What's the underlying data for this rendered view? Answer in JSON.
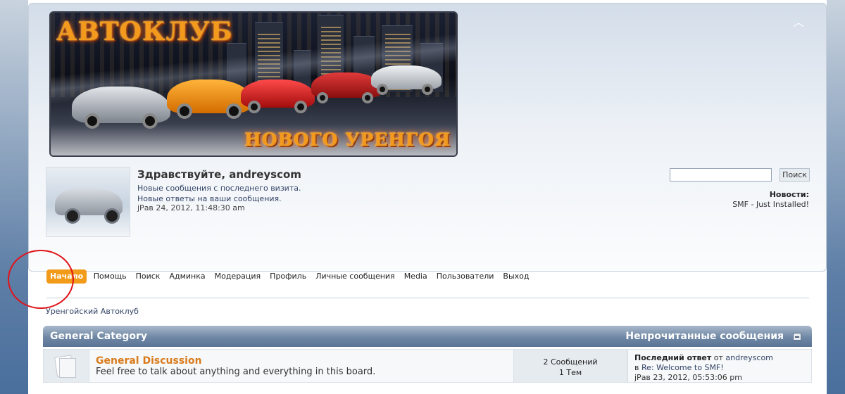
{
  "header": {
    "banner_title_line1": "АВТОКЛУБ",
    "banner_title_line2": "НОВОГО УРЕНГОЯ",
    "collapse_glyph": "︿"
  },
  "user": {
    "greeting": "Здравствуйте, andreyscom",
    "new_posts_since_last_visit": "Новые сообщения с последнего визита.",
    "new_replies": "Новые ответы на ваши сообщения.",
    "datetime": "jРав 24, 2012, 11:48:30 am"
  },
  "search": {
    "placeholder": "",
    "button_label": "Поиск"
  },
  "news": {
    "title": "Новости:",
    "text": "SMF - Just Installed!"
  },
  "menu": {
    "items": [
      {
        "label": "Начало",
        "active": true
      },
      {
        "label": "Помощь"
      },
      {
        "label": "Поиск"
      },
      {
        "label": "Админка"
      },
      {
        "label": "Модерация"
      },
      {
        "label": "Профиль"
      },
      {
        "label": "Личные сообщения"
      },
      {
        "label": "Media"
      },
      {
        "label": "Пользователи"
      },
      {
        "label": "Выход"
      }
    ]
  },
  "breadcrumb": "Уренгойский Автоклуб",
  "category": {
    "title": "General Category",
    "unread_label": "Непрочитанные сообщения"
  },
  "board": {
    "name": "General Discussion",
    "description": "Feel free to talk about anything and everything in this board.",
    "posts": "2 Сообщений",
    "topics": "1 Тем",
    "last_post_label": "Последний ответ",
    "last_post_from": "от",
    "last_post_author": "andreyscom",
    "last_post_in": "в",
    "last_post_topic": "Re: Welcome to SMF!",
    "last_post_time": "jРав 23, 2012, 05:53:06 pm"
  },
  "colors": {
    "accent_orange": "#f29a1a",
    "category_bar": "#6f87a4",
    "highlight_red": "#e0141a"
  }
}
